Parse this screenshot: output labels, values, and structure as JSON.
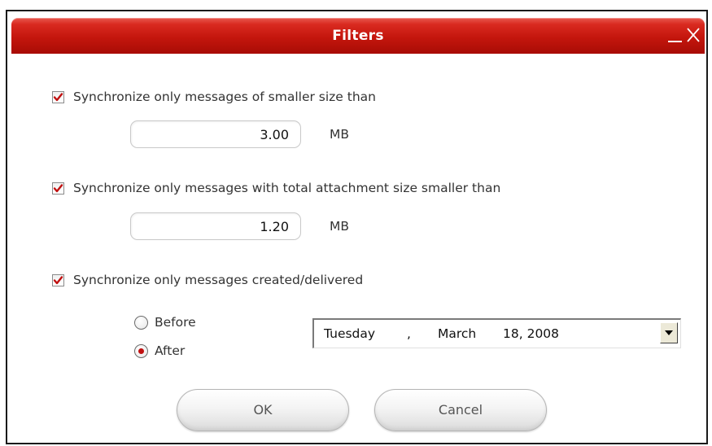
{
  "window": {
    "title": "Filters",
    "accent_color": "#c4160d",
    "controls": [
      "minimize-icon",
      "close-icon"
    ]
  },
  "filters": {
    "size_filter": {
      "checked": true,
      "label": "Synchronize only messages of smaller size than",
      "value": "3.00",
      "unit": "MB"
    },
    "attachment_filter": {
      "checked": true,
      "label": "Synchronize only messages with total attachment size smaller than",
      "value": "1.20",
      "unit": "MB"
    },
    "date_filter": {
      "checked": true,
      "label": "Synchronize only messages created/delivered",
      "options": {
        "before": "Before",
        "after": "After"
      },
      "selected_option": "after",
      "date": {
        "weekday": "Tuesday",
        "separator": ",",
        "month": "March",
        "day_year": "18, 2008"
      }
    }
  },
  "buttons": {
    "ok_label": "OK",
    "cancel_label": "Cancel"
  },
  "icons": {
    "checkmark": "checkmark-icon",
    "dropdown": "dropdown-arrow-icon"
  }
}
